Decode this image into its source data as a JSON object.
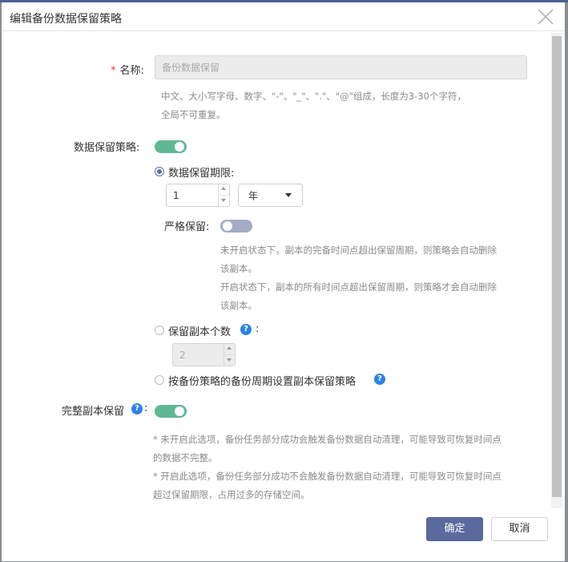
{
  "dialog": {
    "title": "编辑备份数据保留策略"
  },
  "form": {
    "name": {
      "required_mark": "*",
      "label": "名称:",
      "value": "备份数据保留",
      "help_line1": "中文、大小写字母、数字、\"-\"、\"_\"、\".\"、\"@\"组成，长度为3-30个字符，",
      "help_line2": "全局不可重复。"
    },
    "retention_policy": {
      "label": "数据保留策略:",
      "enabled": true
    },
    "period_option": {
      "label": "数据保留期限:",
      "checked": true,
      "amount": "1",
      "unit": "年",
      "strict": {
        "label": "严格保留:",
        "enabled": false,
        "help_line1": "未开启状态下，副本的完备时间点超出保留周期，则策略会自动删除",
        "help_line2": "该副本。",
        "help_line3": "开启状态下，副本的所有时间点超出保留周期，则策略才会自动删除",
        "help_line4": "该副本。"
      }
    },
    "count_option": {
      "label": "保留副本个数",
      "colon": ":",
      "checked": false,
      "value": "2"
    },
    "cycle_option": {
      "label": "按备份策略的备份周期设置副本保留策略",
      "checked": false
    },
    "full_copy": {
      "label": "完整副本保留",
      "colon": ":",
      "enabled": true,
      "help_line1": "* 未开启此选项，备份任务部分成功会触发备份数据自动清理，可能导致可恢复时间点",
      "help_line2": "的数据不完整。",
      "help_line3": "* 开启此选项，备份任务部分成功不会触发备份数据自动清理，可能导致可恢复时间点",
      "help_line4": "超过保留期限，占用过多的存储空间。"
    }
  },
  "footer": {
    "confirm_label": "确定",
    "cancel_label": "取消"
  },
  "icons": {
    "help": "?",
    "close": "close-icon",
    "dropdown": "chevron-down-icon"
  },
  "colors": {
    "primary": "#5a6a9e",
    "toggle_on": "#5fb894",
    "toggle_off": "#a3abc6",
    "help_icon": "#2b83e6",
    "required": "#e23a3a"
  }
}
